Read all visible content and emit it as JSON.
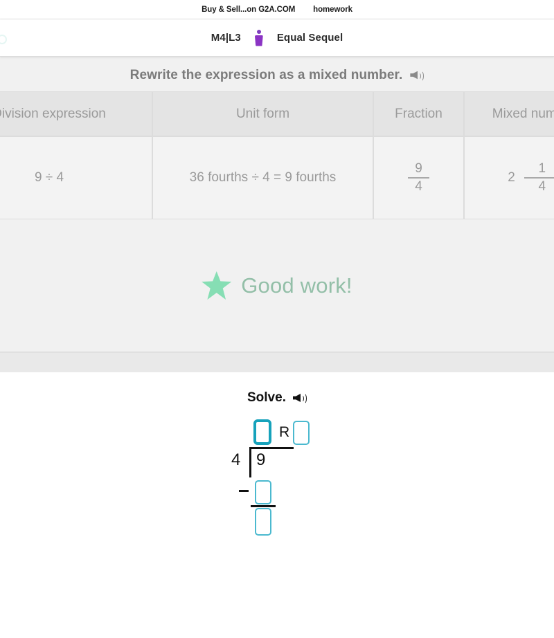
{
  "browser": {
    "bookmarks": [
      {
        "label": "Buy & Sell...on G2A.COM",
        "name": "bookmark-g2a"
      },
      {
        "label": "homework",
        "name": "bookmark-homework"
      }
    ]
  },
  "header": {
    "lesson_code": "M4|L3",
    "lesson_title": "Equal Sequel",
    "avatar_icon": "person-icon"
  },
  "problem": {
    "prompt": "Rewrite the expression as a mixed number.",
    "prompt_audio_icon": "speaker-icon",
    "table": {
      "headers": [
        "Division expression",
        "Unit form",
        "Fraction",
        "Mixed number"
      ],
      "rows": [
        {
          "division_expression": "9 ÷ 4",
          "unit_form": "36 fourths ÷ 4 = 9 fourths",
          "fraction": {
            "numerator": "9",
            "denominator": "4"
          },
          "mixed_number": {
            "whole": "2",
            "numerator": "1",
            "denominator": "4"
          }
        }
      ]
    },
    "feedback": {
      "icon": "star-icon",
      "text": "Good work!",
      "star_color": "#86deb4",
      "text_color": "#93bfa8"
    }
  },
  "solve": {
    "label": "Solve.",
    "audio_icon": "speaker-icon",
    "long_division": {
      "divisor": "4",
      "dividend": "9",
      "remainder_label": "R",
      "quotient_value": "",
      "remainder_value": "",
      "product_value": "",
      "difference_value": "",
      "box_border_color": "#4bb9cf",
      "focused_box_border_color": "#16a2bb",
      "focused_box": "quotient"
    }
  }
}
